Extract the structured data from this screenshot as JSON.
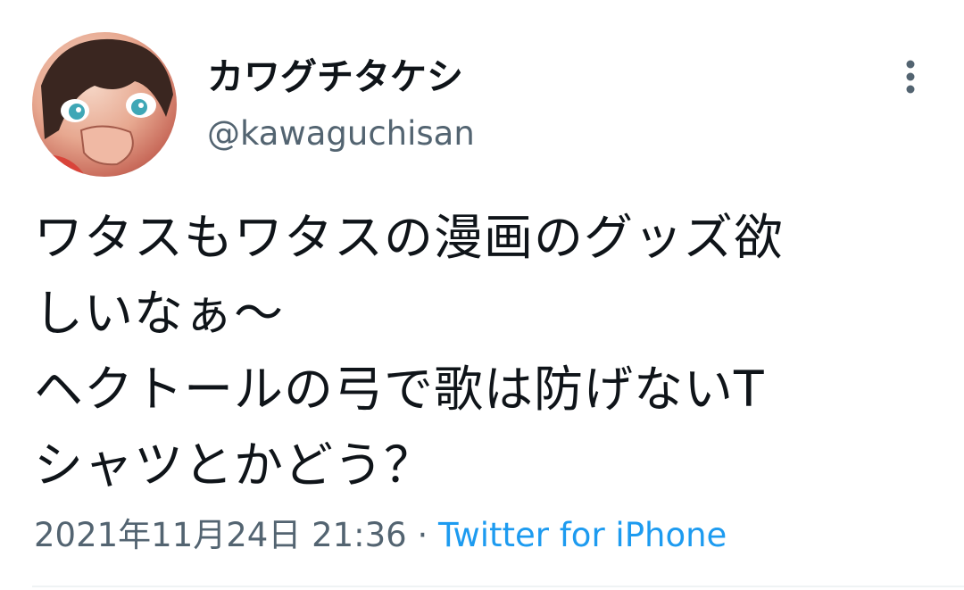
{
  "user": {
    "display_name": "カワグチタケシ",
    "handle": "@kawaguchisan"
  },
  "tweet": {
    "text": "ワタスもワタスの漫画のグッズ欲\nしいなぁ〜\nヘクトールの弓で歌は防げないT\nシャツとかどう？",
    "timestamp": "2021年11月24日 21:36",
    "separator": " · ",
    "source": "Twitter for iPhone"
  },
  "icons": {
    "more": "more-vertical-icon",
    "avatar": "user-avatar-image"
  },
  "colors": {
    "text_primary": "#0f1419",
    "text_secondary": "#536471",
    "link": "#1d9bf0",
    "divider": "#eff3f4"
  }
}
